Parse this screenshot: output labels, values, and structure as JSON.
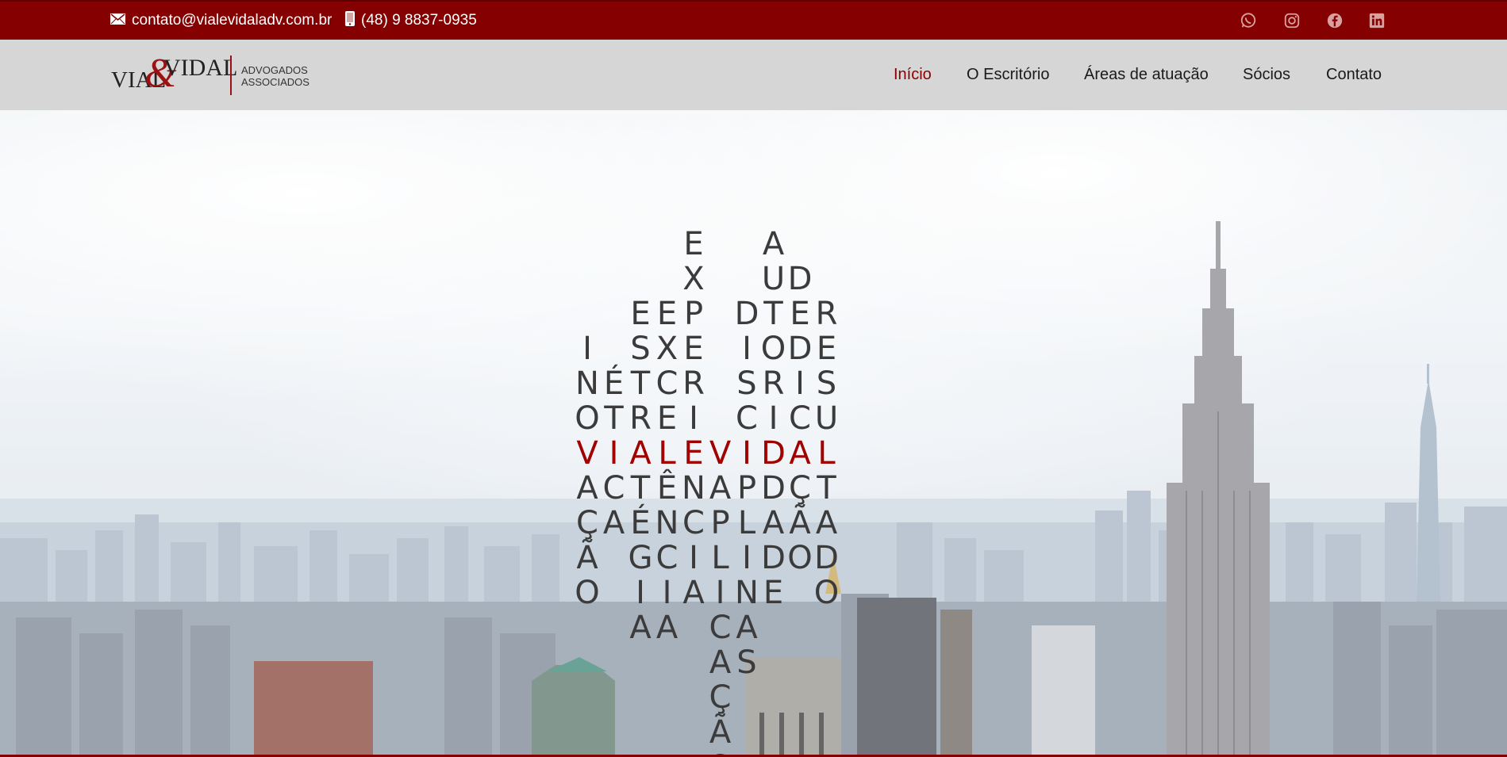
{
  "topbar": {
    "email": "contato@vialevidaladv.com.br",
    "phone": "(48) 9 8837-0935",
    "email_icon": "mail-icon",
    "phone_icon": "mobile-phone-icon",
    "social": [
      {
        "name": "whatsapp-icon"
      },
      {
        "name": "instagram-icon"
      },
      {
        "name": "facebook-icon"
      },
      {
        "name": "linkedin-icon"
      }
    ],
    "bg_color": "#850000"
  },
  "logo": {
    "vial": "VIAL",
    "amp": "&",
    "vidal": "VIDAL",
    "sub1": "ADVOGADOS",
    "sub2": "ASSOCIADOS"
  },
  "nav": {
    "items": [
      {
        "label": "Início",
        "active": true
      },
      {
        "label": "O Escritório",
        "active": false
      },
      {
        "label": "Áreas de atuação",
        "active": false
      },
      {
        "label": "Sócios",
        "active": false
      },
      {
        "label": "Contato",
        "active": false
      }
    ],
    "active_color": "#8a0000"
  },
  "hero": {
    "highlight_word": "VIALEVIDAL",
    "highlight_color": "#a00000",
    "crossword_columns": [
      {
        "above": "INO",
        "below": "AÇÃO"
      },
      {
        "above": "ÉT",
        "below": "CA"
      },
      {
        "above": "ESTR",
        "below": "TÉGIA"
      },
      {
        "above": "EXCE",
        "below": "ÊNCIA"
      },
      {
        "above": "EXPERI",
        "below": "NCIA"
      },
      {
        "above": "",
        "below": "APLICAÇÃO"
      },
      {
        "above": "DISC",
        "below": "PLINAS"
      },
      {
        "above": "AUTORI",
        "below": "DADE"
      },
      {
        "above": "DEDIC",
        "below": "ÇÃO"
      },
      {
        "above": "RESU",
        "below": "TADO"
      }
    ]
  }
}
